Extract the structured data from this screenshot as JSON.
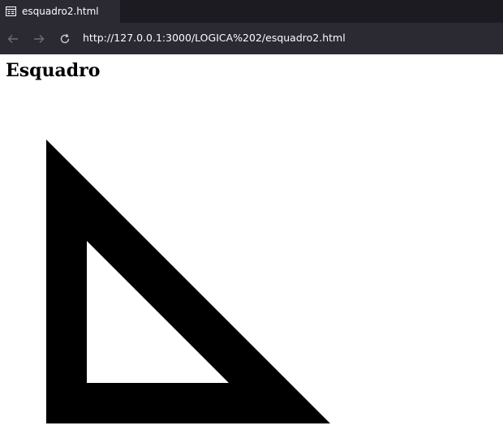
{
  "browser": {
    "tab": {
      "title": "esquadro2.html",
      "icon": "page-icon"
    },
    "nav": {
      "back_icon": "back-arrow-icon",
      "forward_icon": "forward-arrow-icon",
      "reload_icon": "reload-icon",
      "url": "http://127.0.0.1:3000/LOGICA%202/esquadro2.html"
    },
    "colors": {
      "chrome_dark": "#1c1b22",
      "chrome": "#2b2a33",
      "text": "#fbfbfe",
      "icon": "#8f8f9d"
    }
  },
  "page": {
    "heading": "Esquadro",
    "shape": {
      "name": "set-square",
      "fill": "#000000",
      "hole": "#ffffff"
    }
  }
}
